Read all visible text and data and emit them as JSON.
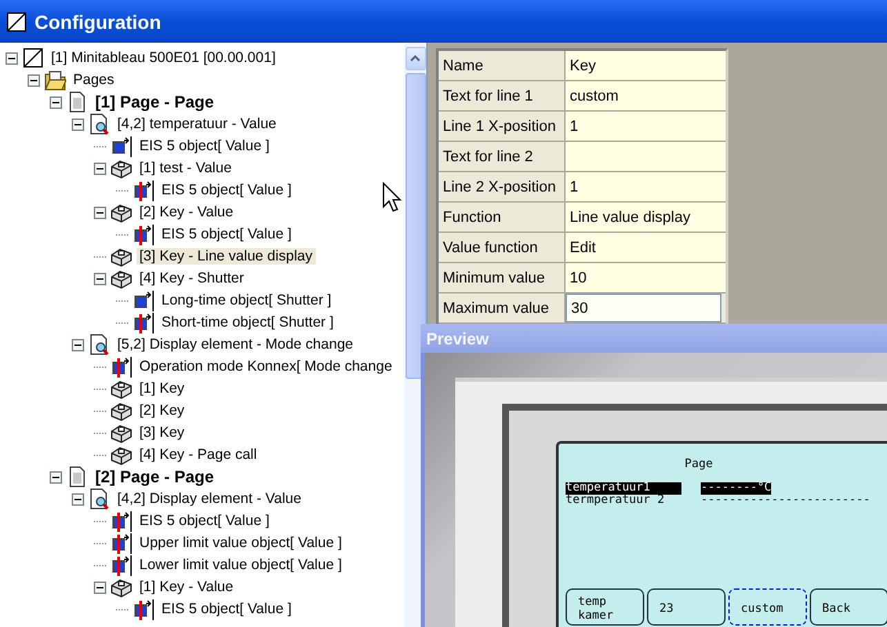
{
  "window": {
    "title": "Configuration"
  },
  "tree": [
    {
      "label": "[1] Minitableau 500E01 [00.00.001]",
      "kind": "device",
      "selected": false,
      "expanded": true,
      "children": [
        {
          "label": "Pages",
          "kind": "folder",
          "selected": false,
          "expanded": true,
          "children": [
            {
              "label": "[1] Page - Page",
              "kind": "page",
              "selected": false,
              "expanded": true,
              "children": [
                {
                  "label": "[4,2] temperatuur - Value",
                  "kind": "element",
                  "selected": false,
                  "expanded": true,
                  "children": [
                    {
                      "label": "EIS 5 object[ Value ]",
                      "kind": "object",
                      "selected": false,
                      "marked": false
                    },
                    {
                      "label": "[1] test - Value",
                      "kind": "key",
                      "selected": false,
                      "expanded": true,
                      "children": [
                        {
                          "label": "EIS 5 object[ Value ]",
                          "kind": "object",
                          "selected": false,
                          "marked": true
                        }
                      ]
                    },
                    {
                      "label": "[2] Key - Value",
                      "kind": "key",
                      "selected": false,
                      "expanded": true,
                      "children": [
                        {
                          "label": "EIS 5 object[ Value ]",
                          "kind": "object",
                          "selected": false,
                          "marked": true
                        }
                      ]
                    },
                    {
                      "label": "[3] Key - Line value display",
                      "kind": "key",
                      "selected": true
                    },
                    {
                      "label": "[4] Key - Shutter",
                      "kind": "key",
                      "selected": false,
                      "expanded": true,
                      "children": [
                        {
                          "label": "Long-time object[ Shutter ]",
                          "kind": "object",
                          "selected": false,
                          "marked": false
                        },
                        {
                          "label": "Short-time object[ Shutter ]",
                          "kind": "object",
                          "selected": false,
                          "marked": true
                        }
                      ]
                    }
                  ]
                },
                {
                  "label": "[5,2] Display element - Mode change",
                  "kind": "element",
                  "selected": false,
                  "expanded": true,
                  "children": [
                    {
                      "label": "Operation mode Konnex[ Mode change",
                      "kind": "object",
                      "selected": false,
                      "marked": true
                    },
                    {
                      "label": "[1] Key",
                      "kind": "key",
                      "selected": false
                    },
                    {
                      "label": "[2] Key",
                      "kind": "key",
                      "selected": false
                    },
                    {
                      "label": "[3] Key",
                      "kind": "key",
                      "selected": false
                    },
                    {
                      "label": "[4] Key - Page call",
                      "kind": "key",
                      "selected": false
                    }
                  ]
                }
              ]
            },
            {
              "label": "[2] Page - Page",
              "kind": "page",
              "selected": false,
              "expanded": true,
              "children": [
                {
                  "label": "[4,2] Display element - Value",
                  "kind": "element",
                  "selected": false,
                  "expanded": true,
                  "children": [
                    {
                      "label": "EIS 5 object[ Value ]",
                      "kind": "object",
                      "selected": false,
                      "marked": true
                    },
                    {
                      "label": "Upper limit value object[ Value ]",
                      "kind": "object",
                      "selected": false,
                      "marked": true
                    },
                    {
                      "label": "Lower limit value object[ Value ]",
                      "kind": "object",
                      "selected": false,
                      "marked": true
                    },
                    {
                      "label": "[1] Key - Value",
                      "kind": "key",
                      "selected": false,
                      "expanded": true,
                      "children": [
                        {
                          "label": "EIS 5 object[ Value ]",
                          "kind": "object",
                          "selected": false,
                          "marked": true
                        }
                      ]
                    }
                  ]
                }
              ]
            }
          ]
        }
      ]
    }
  ],
  "properties": [
    {
      "name": "Name",
      "value": "Key",
      "selected": false
    },
    {
      "name": "Text for line 1",
      "value": "custom",
      "selected": false
    },
    {
      "name": "Line 1 X-position",
      "value": "1",
      "selected": false
    },
    {
      "name": "Text for line 2",
      "selected": false
    },
    {
      "name": "Line 2 X-position",
      "value": "1",
      "selected": false
    },
    {
      "name": "Function",
      "value": "Line value display",
      "selected": false
    },
    {
      "name": "Value function",
      "value": "Edit",
      "selected": false
    },
    {
      "name": "Minimum value",
      "value": "10",
      "selected": false
    },
    {
      "name": "Maximum value",
      "value": "30",
      "selected": true
    }
  ],
  "preview": {
    "title": "Preview",
    "lcd": {
      "heading": "Page",
      "lines": [
        {
          "label": "temperatuur1",
          "reading": "--------°C",
          "selected": true
        },
        {
          "label": "termperatuur 2",
          "reading": "------------------------",
          "selected": false
        }
      ],
      "softkeys": [
        {
          "label": "temp\nkamer",
          "focused": false
        },
        {
          "label": "23",
          "focused": false
        },
        {
          "label": "custom",
          "focused": true
        },
        {
          "label": "Back",
          "focused": false
        }
      ]
    }
  }
}
